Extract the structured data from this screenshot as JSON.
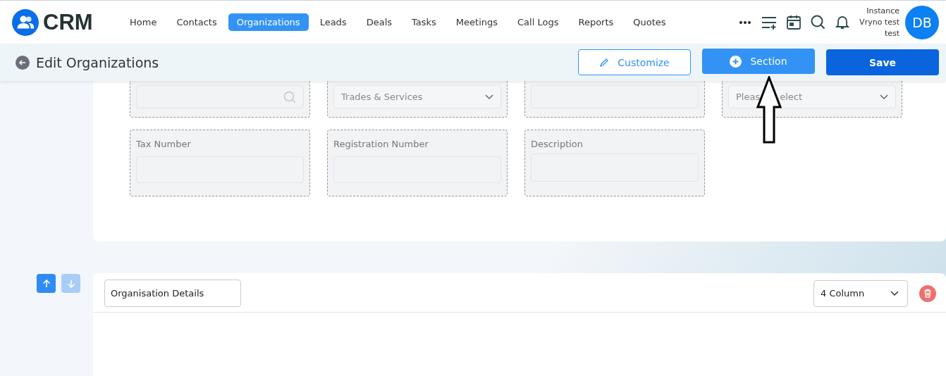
{
  "brand": "CRM",
  "nav": [
    {
      "label": "Home",
      "selected": false
    },
    {
      "label": "Contacts",
      "selected": false
    },
    {
      "label": "Organizations",
      "selected": true
    },
    {
      "label": "Leads",
      "selected": false
    },
    {
      "label": "Deals",
      "selected": false
    },
    {
      "label": "Tasks",
      "selected": false
    },
    {
      "label": "Meetings",
      "selected": false
    },
    {
      "label": "Call Logs",
      "selected": false
    },
    {
      "label": "Reports",
      "selected": false
    },
    {
      "label": "Quotes",
      "selected": false
    }
  ],
  "user": {
    "lines": [
      "Instance",
      "Vryno test",
      "test"
    ],
    "initials": "DB"
  },
  "page_title": "Edit Organizations",
  "actions": [
    {
      "label": "Customize",
      "kind": "outline"
    },
    {
      "label": "Section",
      "kind": "light"
    },
    {
      "label": "Save",
      "kind": "primary"
    }
  ],
  "field_rows": [
    [
      {
        "kind": "search"
      },
      {
        "kind": "select",
        "value": "Trades & Services"
      },
      {
        "kind": "text"
      },
      {
        "kind": "select",
        "placeholder_fragments": [
          "Pleas",
          "elect"
        ]
      }
    ],
    [
      {
        "kind": "text",
        "label": "Tax Number"
      },
      {
        "kind": "text",
        "label": "Registration Number"
      },
      {
        "kind": "textarea",
        "label": "Description"
      }
    ]
  ],
  "section": {
    "move_up": {
      "disabled": false
    },
    "move_down": {
      "disabled": true
    },
    "name": "Organisation Details",
    "columns": "4 Column"
  }
}
